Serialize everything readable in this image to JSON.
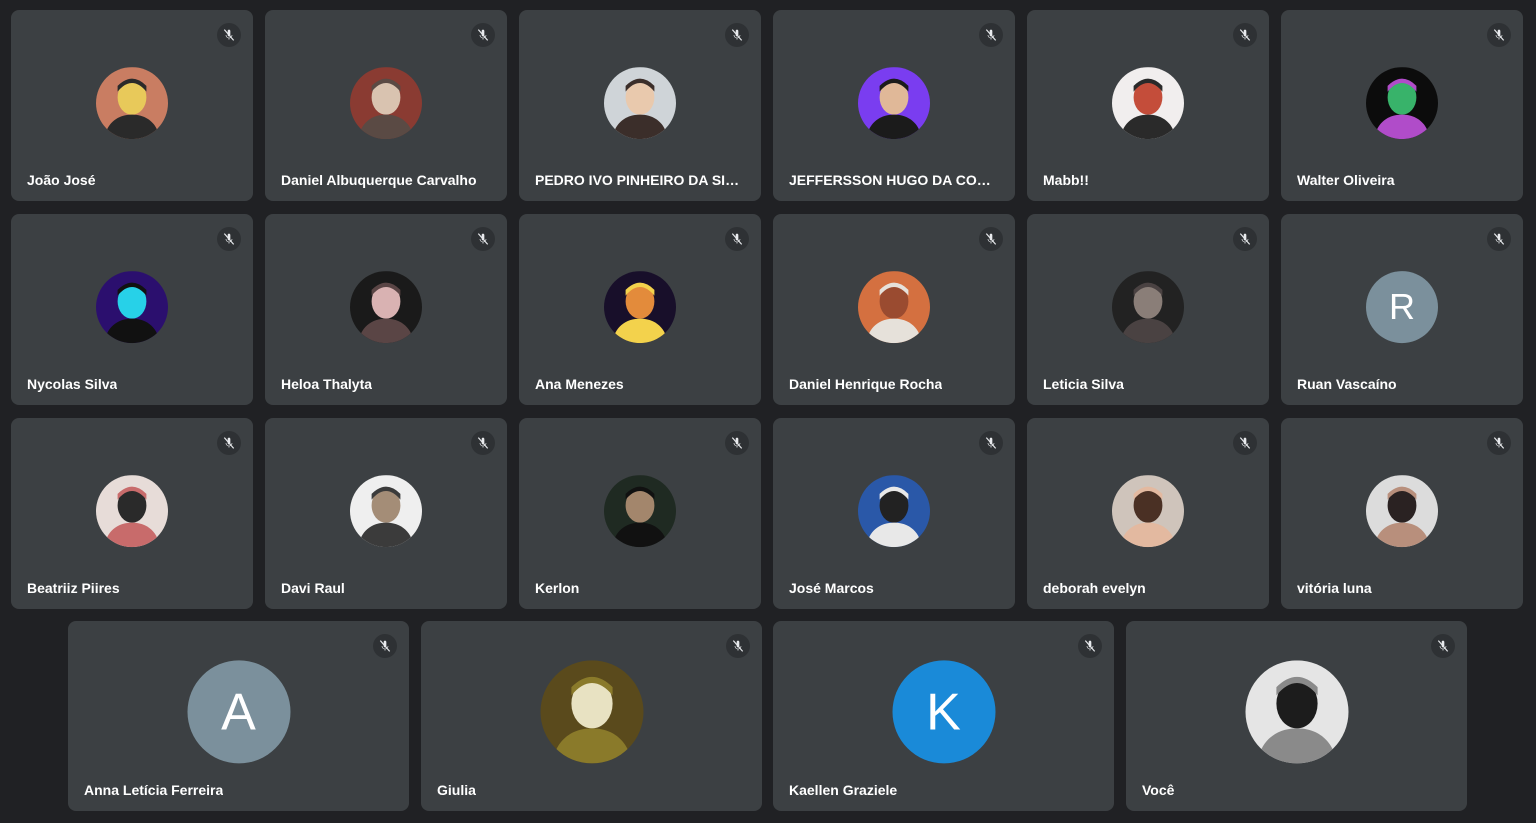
{
  "participants": [
    {
      "name": "João José",
      "avatar_type": "photo",
      "colors": [
        "#c97d62",
        "#e8c95a",
        "#2a2a2a"
      ]
    },
    {
      "name": "Daniel Albuquerque Carvalho",
      "avatar_type": "photo",
      "colors": [
        "#8a3b32",
        "#d9c3b0",
        "#5a4a44"
      ]
    },
    {
      "name": "PEDRO IVO PINHEIRO DA SILVA",
      "avatar_type": "photo",
      "colors": [
        "#cfd4d8",
        "#e9c9ad",
        "#3b2e2a"
      ]
    },
    {
      "name": "JEFFERSSON HUGO DA COST...",
      "avatar_type": "photo",
      "colors": [
        "#7a3df0",
        "#e0b898",
        "#1b1b1b"
      ]
    },
    {
      "name": "Mabb!!",
      "avatar_type": "photo",
      "colors": [
        "#f1eeee",
        "#c44d3a",
        "#2a2a2a"
      ]
    },
    {
      "name": "Walter Oliveira",
      "avatar_type": "photo",
      "colors": [
        "#0c0c0c",
        "#38b36a",
        "#b04cc9"
      ]
    },
    {
      "name": "Nycolas Silva",
      "avatar_type": "photo",
      "colors": [
        "#2b0f6e",
        "#27d1e8",
        "#111111"
      ]
    },
    {
      "name": "Heloa Thalyta",
      "avatar_type": "photo",
      "colors": [
        "#1a1a1a",
        "#d9b2b2",
        "#5a4545"
      ]
    },
    {
      "name": "Ana Menezes",
      "avatar_type": "photo",
      "colors": [
        "#180f2a",
        "#e38b3b",
        "#f3d24c"
      ]
    },
    {
      "name": "Daniel Henrique Rocha",
      "avatar_type": "photo",
      "colors": [
        "#d47040",
        "#9a4b30",
        "#e6e1da"
      ]
    },
    {
      "name": "Leticia Silva",
      "avatar_type": "photo",
      "colors": [
        "#222222",
        "#8a7e78",
        "#4a4242"
      ]
    },
    {
      "name": "Ruan Vascaíno",
      "avatar_type": "initial",
      "initial": "R",
      "colors": [
        "#7b909c"
      ]
    },
    {
      "name": "Beatriiz Piires",
      "avatar_type": "photo",
      "colors": [
        "#e7dcd8",
        "#2a2a2a",
        "#c86b6b"
      ]
    },
    {
      "name": "Davi Raul",
      "avatar_type": "photo",
      "colors": [
        "#efefef",
        "#a48d77",
        "#3b3b3b"
      ]
    },
    {
      "name": "Kerlon",
      "avatar_type": "photo",
      "colors": [
        "#1f2a22",
        "#a3866c",
        "#111111"
      ]
    },
    {
      "name": "José Marcos",
      "avatar_type": "photo",
      "colors": [
        "#2a58a8",
        "#222222",
        "#e8e8e8"
      ]
    },
    {
      "name": "deborah evelyn",
      "avatar_type": "photo",
      "colors": [
        "#cfc4bb",
        "#4a3024",
        "#e3b9a0"
      ]
    },
    {
      "name": "vitória luna",
      "avatar_type": "photo",
      "colors": [
        "#dcdcdc",
        "#2a2222",
        "#b88f7c"
      ]
    },
    {
      "name": "Anna Letícia Ferreira",
      "avatar_type": "initial",
      "initial": "A",
      "colors": [
        "#7b909c"
      ]
    },
    {
      "name": "Giulia",
      "avatar_type": "photo",
      "colors": [
        "#5a4a1c",
        "#e8e2c2",
        "#8a7a2a"
      ]
    },
    {
      "name": "Kaellen Graziele",
      "avatar_type": "initial",
      "initial": "K",
      "colors": [
        "#1a8ad8"
      ]
    },
    {
      "name": "Você",
      "avatar_type": "photo",
      "colors": [
        "#e5e5e5",
        "#1c1c1c",
        "#8a8a8a"
      ]
    }
  ],
  "mute_icon": "mic-off-icon",
  "theme": {
    "background": "#202124",
    "tile": "#3c4043",
    "text": "#ffffff"
  }
}
